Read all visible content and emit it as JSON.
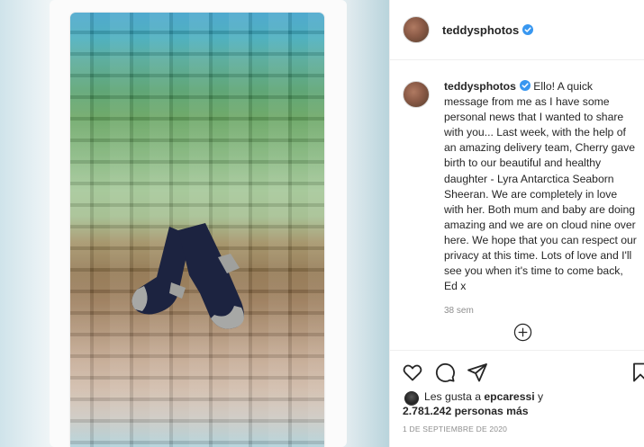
{
  "post": {
    "username": "teddysphotos",
    "caption": "Ello! A quick message from me as I have some personal news that I wanted to share with you... Last week, with the help of an amazing delivery team, Cherry gave birth to our beautiful and healthy daughter - Lyra Antarctica Seaborn Sheeran. We are completely in love with her. Both mum and baby are doing amazing and we are on cloud nine over here. We hope that you can respect our privacy at this time. Lots of love and I'll see you when it's time to come back, Ed x",
    "time_ago": "38 sem",
    "likes_prefix": "Les gusta a",
    "likes_user": "epcaressi",
    "likes_suffix": "y",
    "likes_count": "2.781.242 personas más",
    "date": "1 DE SEPTIEMBRE DE 2020"
  },
  "icons": {
    "verified": "verified-badge-icon",
    "like": "heart-icon",
    "comment": "comment-icon",
    "share": "paper-plane-icon",
    "save": "bookmark-icon",
    "load_more": "plus-circle-icon"
  },
  "colors": {
    "verified_blue": "#3897f0",
    "text": "#262626",
    "muted": "#8e8e8e",
    "border": "#efefef"
  }
}
